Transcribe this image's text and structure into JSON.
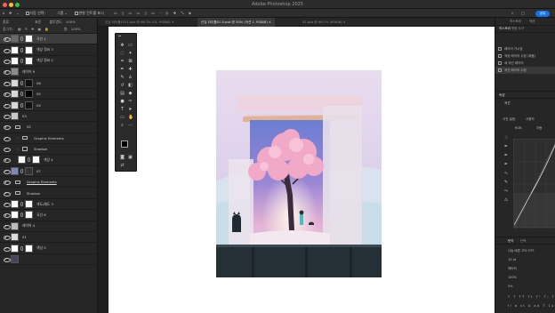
{
  "app": {
    "title": "Adobe Photoshop 2025"
  },
  "options_bar": {
    "move_tool": "✥",
    "auto_select_label": "자동 선택:",
    "auto_select_value": "그룹",
    "transform_label": "변형 컨트롤 표시",
    "share_label": "공유"
  },
  "layers_panel": {
    "kind_label": "종류",
    "blend_mode": "표준",
    "opacity_label": "불투명도:",
    "opacity_value": "100%",
    "lock_label": "잠그기:",
    "fill_label": "칠:",
    "fill_value": "100%",
    "layers": [
      {
        "name": "곡선 1",
        "type": "adjust",
        "selected": true,
        "thumb": "#6a6a6a",
        "mask": true
      },
      {
        "name": "색상 정씨 3",
        "type": "fill",
        "thumb": "#ffffff",
        "mask": true
      },
      {
        "name": "색상 정씨 2",
        "type": "fill",
        "thumb": "#ffffff",
        "mask": true
      },
      {
        "name": "레이어 9",
        "type": "layer",
        "thumb": "#8c8c8c",
        "mask": false
      },
      {
        "name": "06",
        "type": "layer",
        "thumb": "#d8d8d8",
        "mask": true,
        "mask_color": "#111"
      },
      {
        "name": "05",
        "type": "layer",
        "thumb": "#d8d8d8",
        "mask": true,
        "mask_color": "#000"
      },
      {
        "name": "04",
        "type": "layer",
        "thumb": "#d8d8d8",
        "mask": true,
        "mask_color": "#111"
      },
      {
        "name": "03",
        "type": "layer",
        "thumb": "#c9c9c9",
        "mask": false
      },
      {
        "name": "02",
        "type": "group"
      },
      {
        "name": "Graphic Elements",
        "type": "group",
        "indent": true
      },
      {
        "name": "Shadow",
        "type": "group",
        "indent": true
      },
      {
        "name": "색상 4",
        "type": "fill",
        "indent": true,
        "thumb": "#ffffff",
        "mask": true
      },
      {
        "name": "07",
        "type": "layer",
        "thumb": "#7d86c0",
        "mask": true,
        "mask_color": "#333"
      },
      {
        "name": "Graphic Elements",
        "type": "group",
        "link": true
      },
      {
        "name": "Shadow",
        "type": "group"
      },
      {
        "name": "색도/채도 3",
        "type": "adjust",
        "thumb": "#ffffff",
        "mask": true
      },
      {
        "name": "곡선 6",
        "type": "adjust",
        "thumb": "#ffffff",
        "mask": true
      },
      {
        "name": "레이어 4",
        "type": "layer",
        "thumb": "#bdbdbd",
        "mask": false
      },
      {
        "name": "01",
        "type": "layer",
        "thumb": "#dcdcdc",
        "mask": false
      },
      {
        "name": "색상 5",
        "type": "fill",
        "thumb": "#ffffff",
        "mask": true
      },
      {
        "name": "",
        "type": "layer",
        "thumb": "#44475a",
        "mask": false
      }
    ]
  },
  "tabs": [
    {
      "label": "신입 타이틀1511.psd @ 66.7% (01, RGB/8) ✕"
    },
    {
      "label": "신입 타이틀01 A.psd @ 50% (곡선 1, RGB/8) ✕",
      "active": true
    },
    {
      "label": "02.psd @ 66.7% (RGB/8) ✕"
    }
  ],
  "history_panel": {
    "tabs": [
      "히스토리",
      "액션",
      "명령 도구"
    ],
    "items": [
      {
        "label": "레이어 가시성"
      },
      {
        "label": "색상 레이어 수정 (채움)"
      },
      {
        "label": "새 곡선 레이어"
      },
      {
        "label": "곡선 레이어 수정",
        "selected": true
      }
    ]
  },
  "properties_panel": {
    "title": "속성",
    "section": "곡선",
    "preset_label": "사전 설정:",
    "preset_value": "사용자",
    "channel_value": "RGB",
    "character": {
      "tabs": [
        "문자",
        "단락"
      ],
      "font_name": "나눔 바른 고딕 OTF",
      "size": "15 pt",
      "tracking": "메트릭",
      "opacity": "100%",
      "scale": "0%",
      "auto": "자동"
    }
  },
  "colors": {
    "accent": "#1473e6",
    "panel_bg": "#262626",
    "selection": "#3d3d3d"
  }
}
